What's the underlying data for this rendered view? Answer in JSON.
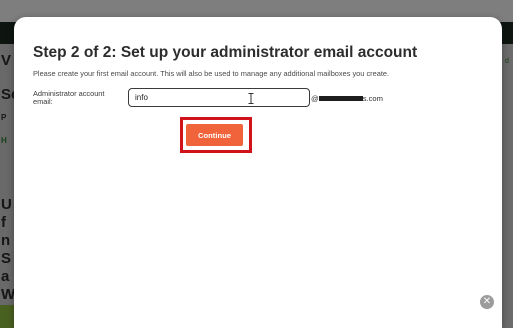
{
  "background": {
    "side_letters": [
      "V",
      "Se",
      "P",
      "H",
      "U",
      "f",
      "n",
      "S",
      "a",
      "W"
    ],
    "right_link": "d"
  },
  "modal": {
    "title": "Step 2 of 2: Set up your administrator email account",
    "subtitle": "Please create your first email account. This will also be used to manage any additional mailboxes you create.",
    "field_label": "Administrator account email:",
    "email_value": "info",
    "domain_prefix": "@",
    "domain_suffix": "s.com",
    "continue_label": "Continue",
    "close_glyph": "✕"
  },
  "colors": {
    "accent": "#f0633b",
    "highlight": "#d1121b",
    "header_dark": "#1b2a1f",
    "banner_green": "#8dbb3f"
  },
  "icons": [
    "text-cursor-icon",
    "close-icon"
  ]
}
